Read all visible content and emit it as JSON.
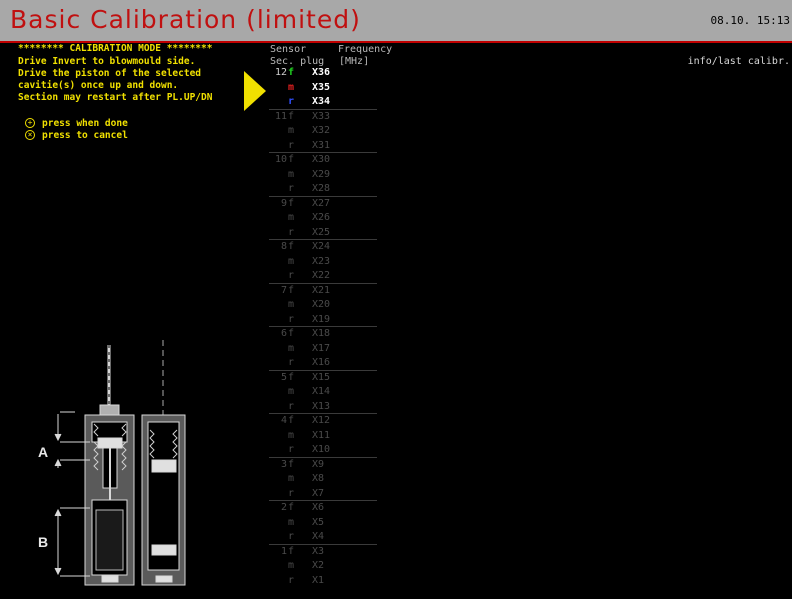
{
  "window": {
    "title": "Basic Calibration (limited)",
    "datetime": "08.10. 15:13"
  },
  "instructions": [
    "******** CALIBRATION MODE ********",
    "Drive Invert to blowmould side.",
    "Drive the piston of the selected",
    "cavitie(s) once up and down.",
    "Section may restart after PL.UP/DN"
  ],
  "hints": {
    "done_icon": "plus-circle-icon",
    "done": "press when done",
    "cancel_icon": "x-circle-icon",
    "cancel": "press to cancel"
  },
  "sensor_table": {
    "header_sensor": "Sensor",
    "header_frequency": "Frequency",
    "header_secplug": "Sec. plug",
    "header_unit": "[MHz]",
    "info_label": "info/last calibr.",
    "active_section": 12,
    "letter_colors": {
      "f": "#20d020",
      "m": "#e02020",
      "r": "#3050ff"
    },
    "sections": [
      {
        "sec": "12",
        "plugs": [
          "X36",
          "X35",
          "X34"
        ]
      },
      {
        "sec": "11",
        "plugs": [
          "X33",
          "X32",
          "X31"
        ]
      },
      {
        "sec": "10",
        "plugs": [
          "X30",
          "X29",
          "X28"
        ]
      },
      {
        "sec": "9",
        "plugs": [
          "X27",
          "X26",
          "X25"
        ]
      },
      {
        "sec": "8",
        "plugs": [
          "X24",
          "X23",
          "X22"
        ]
      },
      {
        "sec": "7",
        "plugs": [
          "X21",
          "X20",
          "X19"
        ]
      },
      {
        "sec": "6",
        "plugs": [
          "X18",
          "X17",
          "X16"
        ]
      },
      {
        "sec": "5",
        "plugs": [
          "X15",
          "X14",
          "X13"
        ]
      },
      {
        "sec": "4",
        "plugs": [
          "X12",
          "X11",
          "X10"
        ]
      },
      {
        "sec": "3",
        "plugs": [
          "X9",
          "X8",
          "X7"
        ]
      },
      {
        "sec": "2",
        "plugs": [
          "X6",
          "X5",
          "X4"
        ]
      },
      {
        "sec": "1",
        "plugs": [
          "X3",
          "X2",
          "X1"
        ]
      }
    ],
    "letters": [
      "f",
      "m",
      "r"
    ]
  },
  "diagram": {
    "label_a": "A",
    "label_b": "B"
  },
  "colors": {
    "title_bar": "#a8a8a8",
    "title_text": "#c01010",
    "instruction_text": "#f0e000",
    "background": "#000000"
  }
}
